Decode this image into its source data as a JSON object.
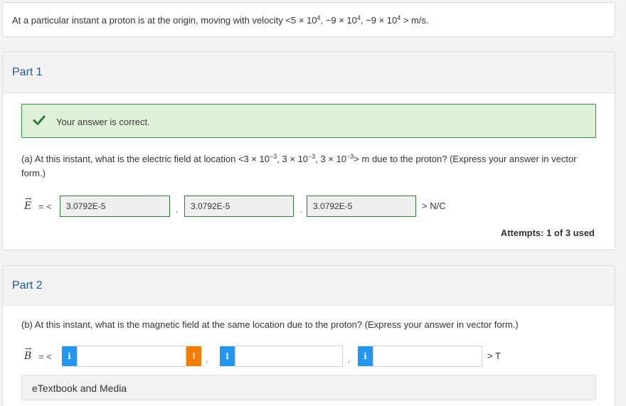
{
  "intro": {
    "prefix": "At a particular instant a proton is at the origin, moving with velocity <5 × 10",
    "exp1": "4",
    "mid1": ", −9 × 10",
    "exp2": "4",
    "mid2": ", −9 × 10",
    "exp3": "4",
    "suffix": "> m/s."
  },
  "part1": {
    "title": "Part 1",
    "feedback": "Your answer is correct.",
    "question": {
      "prefix": "(a) At this instant, what is the electric field at location <3 × 10",
      "exp1": "−3",
      "mid1": ", 3 × 10",
      "exp2": "−3",
      "mid2": ", 3 × 10",
      "exp3": "−3",
      "suffix": "> m due to the proton? (Express your answer in vector form.)"
    },
    "vector_symbol": "E",
    "equals": "= <",
    "answers": [
      "3.0792E-5",
      "3.0792E-5",
      "3.0792E-5"
    ],
    "separator": ",",
    "unit": "> N/C",
    "attempts": "Attempts: 1 of 3 used"
  },
  "part2": {
    "title": "Part 2",
    "question": "(b) At this instant, what is the magnetic field at the same location due to the proton? (Express your answer in vector form.)",
    "vector_symbol": "B",
    "equals": "= <",
    "info_glyph": "i",
    "warn_glyph": "!",
    "separator": ",",
    "unit": "> T",
    "etextbook": "eTextbook and Media"
  },
  "colors": {
    "part_title": "#1f5a9a",
    "success_bg": "#dff0d8",
    "success_border": "#3c8a3e",
    "info_button": "#2196f3",
    "warn_button": "#f57c00"
  },
  "icons": {
    "check": "check-icon",
    "info": "info-icon",
    "warning": "warning-icon",
    "arrow": "vector-arrow-icon"
  }
}
